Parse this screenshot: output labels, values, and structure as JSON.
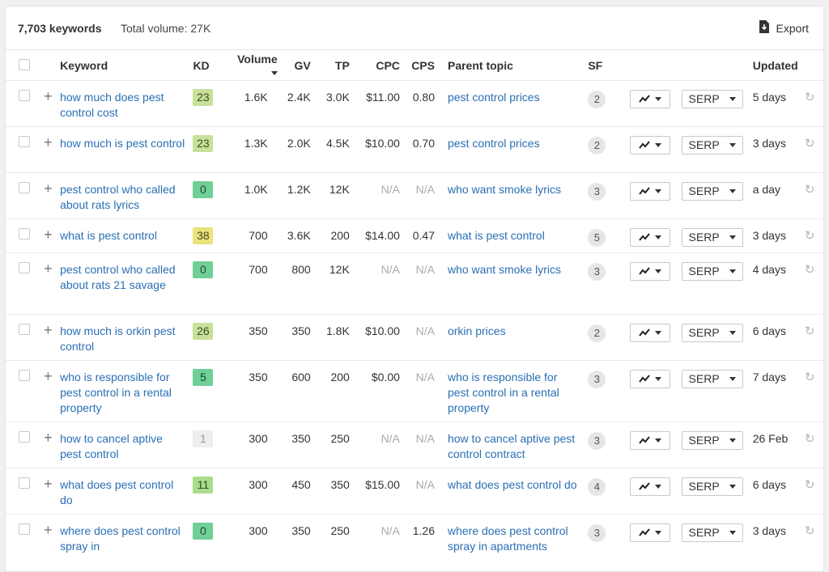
{
  "header": {
    "keywords_count": "7,703 keywords",
    "total_volume": "Total volume: 27K",
    "export_label": "Export"
  },
  "columns": {
    "keyword": "Keyword",
    "kd": "KD",
    "volume": "Volume",
    "gv": "GV",
    "tp": "TP",
    "cpc": "CPC",
    "cps": "CPS",
    "parent_topic": "Parent topic",
    "sf": "SF",
    "updated": "Updated"
  },
  "sort": {
    "column": "Volume",
    "direction": "descending"
  },
  "serp_label": "SERP",
  "icons": {
    "export": "download-icon",
    "add": "plus-icon",
    "trend": "trend-chart-icon",
    "dropdown": "chevron-down-icon",
    "refresh": "refresh-icon"
  },
  "kd_colors": {
    "very_easy": "#6fcf97",
    "easy": "#a9dc8b",
    "easy_medium": "#c8e19a",
    "medium": "#e9e37a",
    "na": "#eeeeee"
  },
  "rows": [
    {
      "keyword": "how much does pest control cost",
      "kd": "23",
      "volume": "1.6K",
      "gv": "2.4K",
      "tp": "3.0K",
      "cpc": "$11.00",
      "cps": "0.80",
      "parent_topic": "pest control prices",
      "sf": "2",
      "updated": "5 days"
    },
    {
      "keyword": "how much is pest control",
      "kd": "23",
      "volume": "1.3K",
      "gv": "2.0K",
      "tp": "4.5K",
      "cpc": "$10.00",
      "cps": "0.70",
      "parent_topic": "pest control prices",
      "sf": "2",
      "updated": "3 days"
    },
    {
      "keyword": "pest control who called about rats lyrics",
      "kd": "0",
      "volume": "1.0K",
      "gv": "1.2K",
      "tp": "12K",
      "cpc": "N/A",
      "cps": "N/A",
      "parent_topic": "who want smoke lyrics",
      "sf": "3",
      "updated": "a day"
    },
    {
      "keyword": "what is pest control",
      "kd": "38",
      "volume": "700",
      "gv": "3.6K",
      "tp": "200",
      "cpc": "$14.00",
      "cps": "0.47",
      "parent_topic": "what is pest control",
      "sf": "5",
      "updated": "3 days"
    },
    {
      "keyword": "pest control who called about rats 21 savage",
      "kd": "0",
      "volume": "700",
      "gv": "800",
      "tp": "12K",
      "cpc": "N/A",
      "cps": "N/A",
      "parent_topic": "who want smoke lyrics",
      "sf": "3",
      "updated": "4 days"
    },
    {
      "keyword": "how much is orkin pest control",
      "kd": "26",
      "volume": "350",
      "gv": "350",
      "tp": "1.8K",
      "cpc": "$10.00",
      "cps": "N/A",
      "parent_topic": "orkin prices",
      "sf": "2",
      "updated": "6 days"
    },
    {
      "keyword": "who is responsible for pest control in a rental property",
      "kd": "5",
      "volume": "350",
      "gv": "600",
      "tp": "200",
      "cpc": "$0.00",
      "cps": "N/A",
      "parent_topic": "who is responsible for pest control in a rental property",
      "sf": "3",
      "updated": "7 days"
    },
    {
      "keyword": "how to cancel aptive pest control",
      "kd": "1",
      "volume": "300",
      "gv": "350",
      "tp": "250",
      "cpc": "N/A",
      "cps": "N/A",
      "parent_topic": "how to cancel aptive pest control contract",
      "sf": "3",
      "updated": "26 Feb"
    },
    {
      "keyword": "what does pest control do",
      "kd": "11",
      "volume": "300",
      "gv": "450",
      "tp": "350",
      "cpc": "$15.00",
      "cps": "N/A",
      "parent_topic": "what does pest control do",
      "sf": "4",
      "updated": "6 days"
    },
    {
      "keyword": "where does pest control spray in",
      "kd": "0",
      "volume": "300",
      "gv": "350",
      "tp": "250",
      "cpc": "N/A",
      "cps": "1.26",
      "parent_topic": "where does pest control spray in apartments",
      "sf": "3",
      "updated": "3 days"
    }
  ]
}
